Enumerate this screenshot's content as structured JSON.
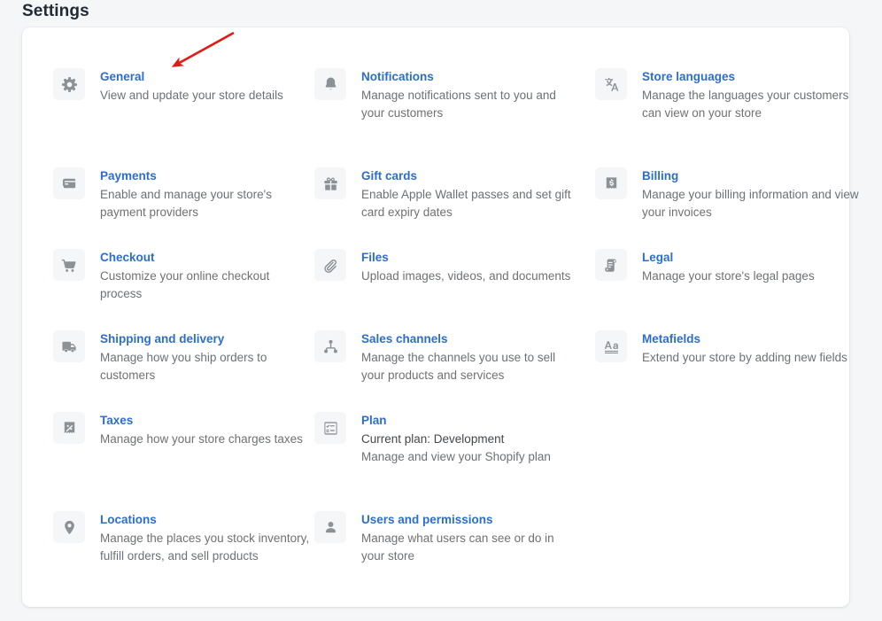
{
  "page": {
    "title": "Settings"
  },
  "annotation": {
    "type": "arrow",
    "color": "#e01b14",
    "points_to": "General"
  },
  "settings": {
    "columns": [
      [
        {
          "icon": "gear-icon",
          "title": "General",
          "desc": "View and update your store details"
        },
        {
          "icon": "credit-card-icon",
          "title": "Payments",
          "desc": "Enable and manage your store's payment providers"
        },
        {
          "icon": "shopping-cart-icon",
          "title": "Checkout",
          "desc": "Customize your online checkout process"
        },
        {
          "icon": "delivery-truck-icon",
          "title": "Shipping and delivery",
          "desc": "Manage how you ship orders to customers"
        },
        {
          "icon": "receipt-percent-icon",
          "title": "Taxes",
          "desc": "Manage how your store charges taxes"
        },
        {
          "icon": "location-pin-icon",
          "title": "Locations",
          "desc": "Manage the places you stock inventory, fulfill orders, and sell products"
        }
      ],
      [
        {
          "icon": "bell-icon",
          "title": "Notifications",
          "desc": "Manage notifications sent to you and your customers"
        },
        {
          "icon": "gift-card-icon",
          "title": "Gift cards",
          "desc": "Enable Apple Wallet passes and set gift card expiry dates"
        },
        {
          "icon": "paperclip-icon",
          "title": "Files",
          "desc": "Upload images, videos, and documents"
        },
        {
          "icon": "sales-channel-icon",
          "title": "Sales channels",
          "desc": "Manage the channels you use to sell your products and services"
        },
        {
          "icon": "checklist-icon",
          "title": "Plan",
          "sub": "Current plan: Development",
          "desc": "Manage and view your Shopify plan"
        },
        {
          "icon": "user-avatar-icon",
          "title": "Users and permissions",
          "desc": "Manage what users can see or do in your store"
        }
      ],
      [
        {
          "icon": "translate-icon",
          "title": "Store languages",
          "desc": "Manage the languages your customers can view on your store"
        },
        {
          "icon": "receipt-dollar-icon",
          "title": "Billing",
          "desc": "Manage your billing information and view your invoices"
        },
        {
          "icon": "legal-scroll-icon",
          "title": "Legal",
          "desc": "Manage your store's legal pages"
        },
        {
          "icon": "metafields-icon",
          "title": "Metafields",
          "desc": "Extend your store by adding new fields"
        }
      ]
    ]
  },
  "colors": {
    "page_background": "#f4f6f8",
    "card_background": "#ffffff",
    "link": "#2c6ecb",
    "text": "#212b36",
    "subdued_text": "#6d7175",
    "icon": "#8c9196",
    "annotation": "#e01b14"
  }
}
